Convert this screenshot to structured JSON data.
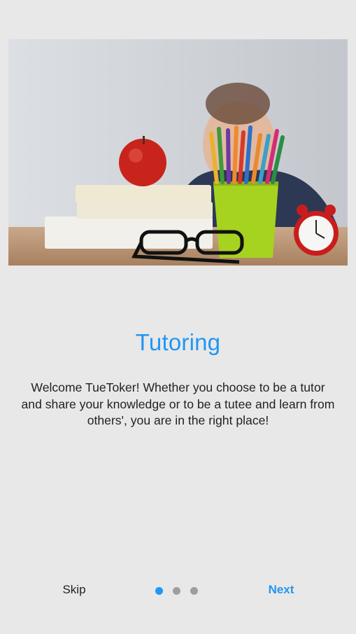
{
  "onboarding": {
    "title": "Tutoring",
    "description": "Welcome TueToker! Whether you choose to be a tutor and share your knowledge or to be a tutee and learn from others', you are in the right place!",
    "image_icon": "classroom-desk-photo",
    "skip_label": "Skip",
    "next_label": "Next",
    "page_indicator": {
      "current_page": 1,
      "total_pages": 3
    }
  },
  "colors": {
    "accent": "#2196f3",
    "background": "#e8e8e8",
    "dot_inactive": "#9e9e9e",
    "text": "#222222"
  }
}
